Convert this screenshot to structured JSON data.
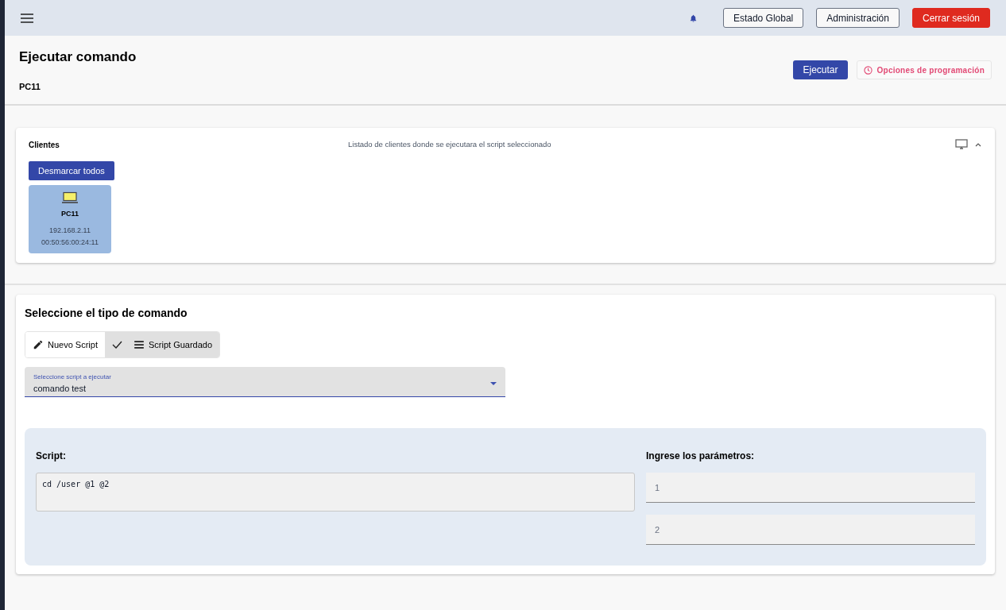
{
  "header": {
    "buttons": [
      {
        "label": "Estado Global",
        "kind": "outline"
      },
      {
        "label": "Administración",
        "kind": "outline"
      },
      {
        "label": "Cerrar sesión",
        "kind": "danger"
      }
    ]
  },
  "page": {
    "title": "Ejecutar comando",
    "subtitle": "PC11",
    "execute_button": "Ejecutar",
    "schedule_button": "Opciones de programación"
  },
  "clients_panel": {
    "title": "Clientes",
    "description": "Listado de clientes donde se ejecutara el script seleccionado",
    "expanded": true,
    "unmark_button": "Desmarcar todos",
    "clients": [
      {
        "name": "PC11",
        "ip": "192.168.2.11",
        "mac": "00:50:56:00:24:11",
        "selected": true
      }
    ]
  },
  "command_panel": {
    "title": "Seleccione el tipo de comando",
    "tabs": [
      {
        "label": "Nuevo Script",
        "kind": "pencil",
        "selected": false
      },
      {
        "label": "Script Guardado",
        "kind": "list",
        "selected": true
      }
    ],
    "select": {
      "label": "Seleccione script a ejecutar",
      "value": "comando test"
    },
    "script_label": "Script:",
    "script": "cd /user @1 @2",
    "params_label": "Ingrese los parámetros:",
    "params": [
      {
        "placeholder": "1"
      },
      {
        "placeholder": "2"
      }
    ]
  }
}
